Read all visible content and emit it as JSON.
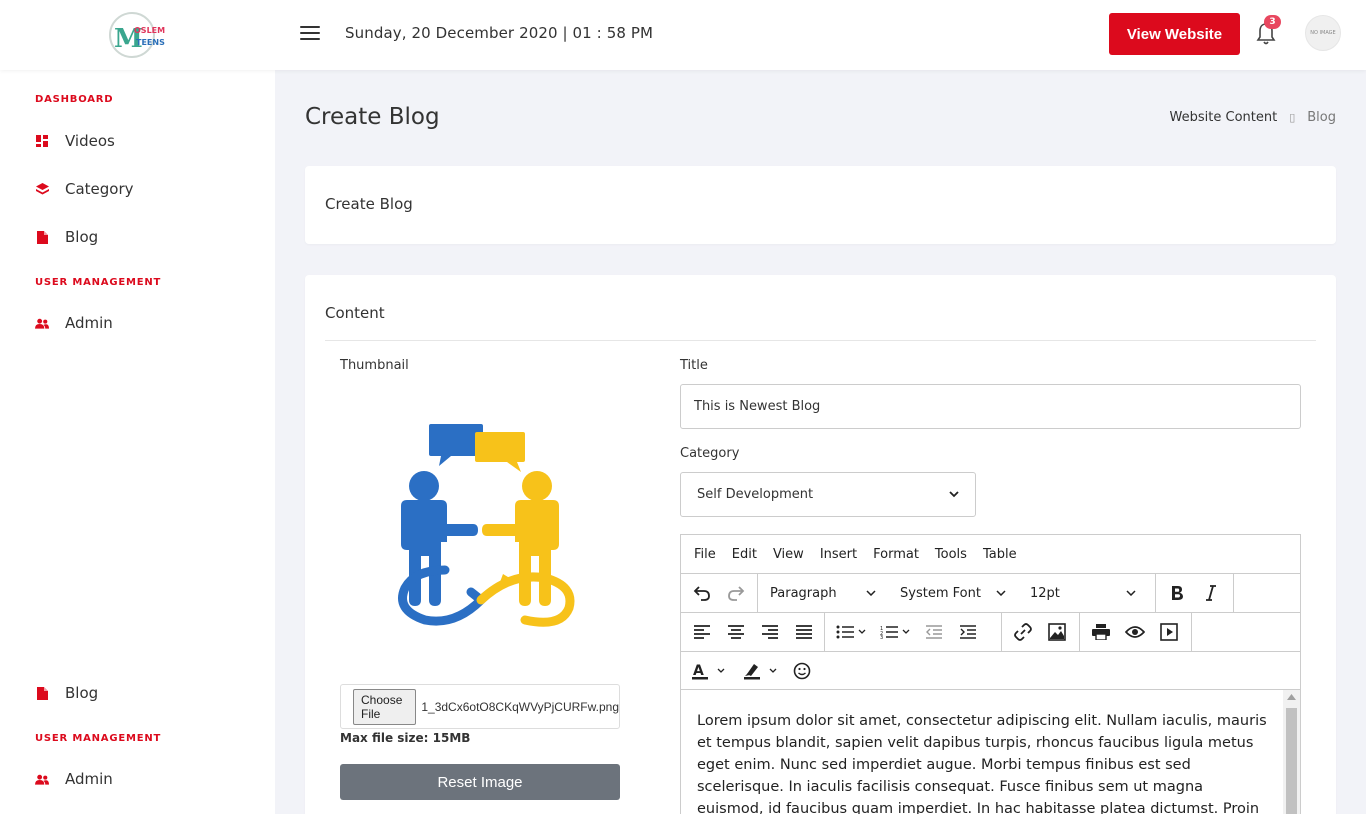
{
  "header": {
    "logo_text": "MOSLEM TEENS",
    "datetime": "Sunday, 20 December 2020 | 01 : 58 PM",
    "view_website_label": "View Website",
    "notification_count": "3",
    "avatar_text": "NO IMAGE"
  },
  "sidebar": {
    "sections": [
      {
        "label": "DASHBOARD",
        "items": [
          {
            "label": "Videos",
            "icon": "dashboard-grid-icon"
          },
          {
            "label": "Category",
            "icon": "layers-icon"
          },
          {
            "label": "Blog",
            "icon": "file-icon"
          }
        ]
      },
      {
        "label": "USER MANAGEMENT",
        "items": [
          {
            "label": "Admin",
            "icon": "users-icon"
          }
        ]
      }
    ],
    "bottom_items": {
      "blog": "Blog",
      "section": "USER MANAGEMENT",
      "admin": "Admin"
    }
  },
  "page": {
    "title": "Create Blog",
    "breadcrumb": [
      "Website Content",
      "Blog"
    ],
    "breadcrumb_sep": "▯"
  },
  "card1": {
    "title": "Create Blog"
  },
  "form": {
    "section_title": "Content",
    "thumbnail_label": "Thumbnail",
    "choose_file_label": "Choose File",
    "file_name": "1_3dCx6otO8CKqWVyPjCURFw.png",
    "max_file_size": "Max file size: 15MB",
    "reset_label": "Reset Image",
    "title_label": "Title",
    "title_value": "This is Newest Blog",
    "category_label": "Category",
    "category_value": "Self Development"
  },
  "editor": {
    "menu": [
      "File",
      "Edit",
      "View",
      "Insert",
      "Format",
      "Tools",
      "Table"
    ],
    "block_format": "Paragraph",
    "font_family": "System Font",
    "font_size": "12pt",
    "content": "Lorem ipsum dolor sit amet, consectetur adipiscing elit. Nullam iaculis, mauris et tempus blandit, sapien velit dapibus turpis, rhoncus faucibus ligula metus eget enim. Nunc sed imperdiet augue. Morbi tempus finibus est sed scelerisque. In iaculis facilisis consequat. Fusce finibus sem ut magna euismod, id faucibus quam imperdiet. In hac habitasse platea dictumst. Proin purus risus, euismod eu"
  },
  "colors": {
    "accent": "#dc0a1d",
    "reset_button": "#6c737c",
    "badge": "#e8475f"
  }
}
